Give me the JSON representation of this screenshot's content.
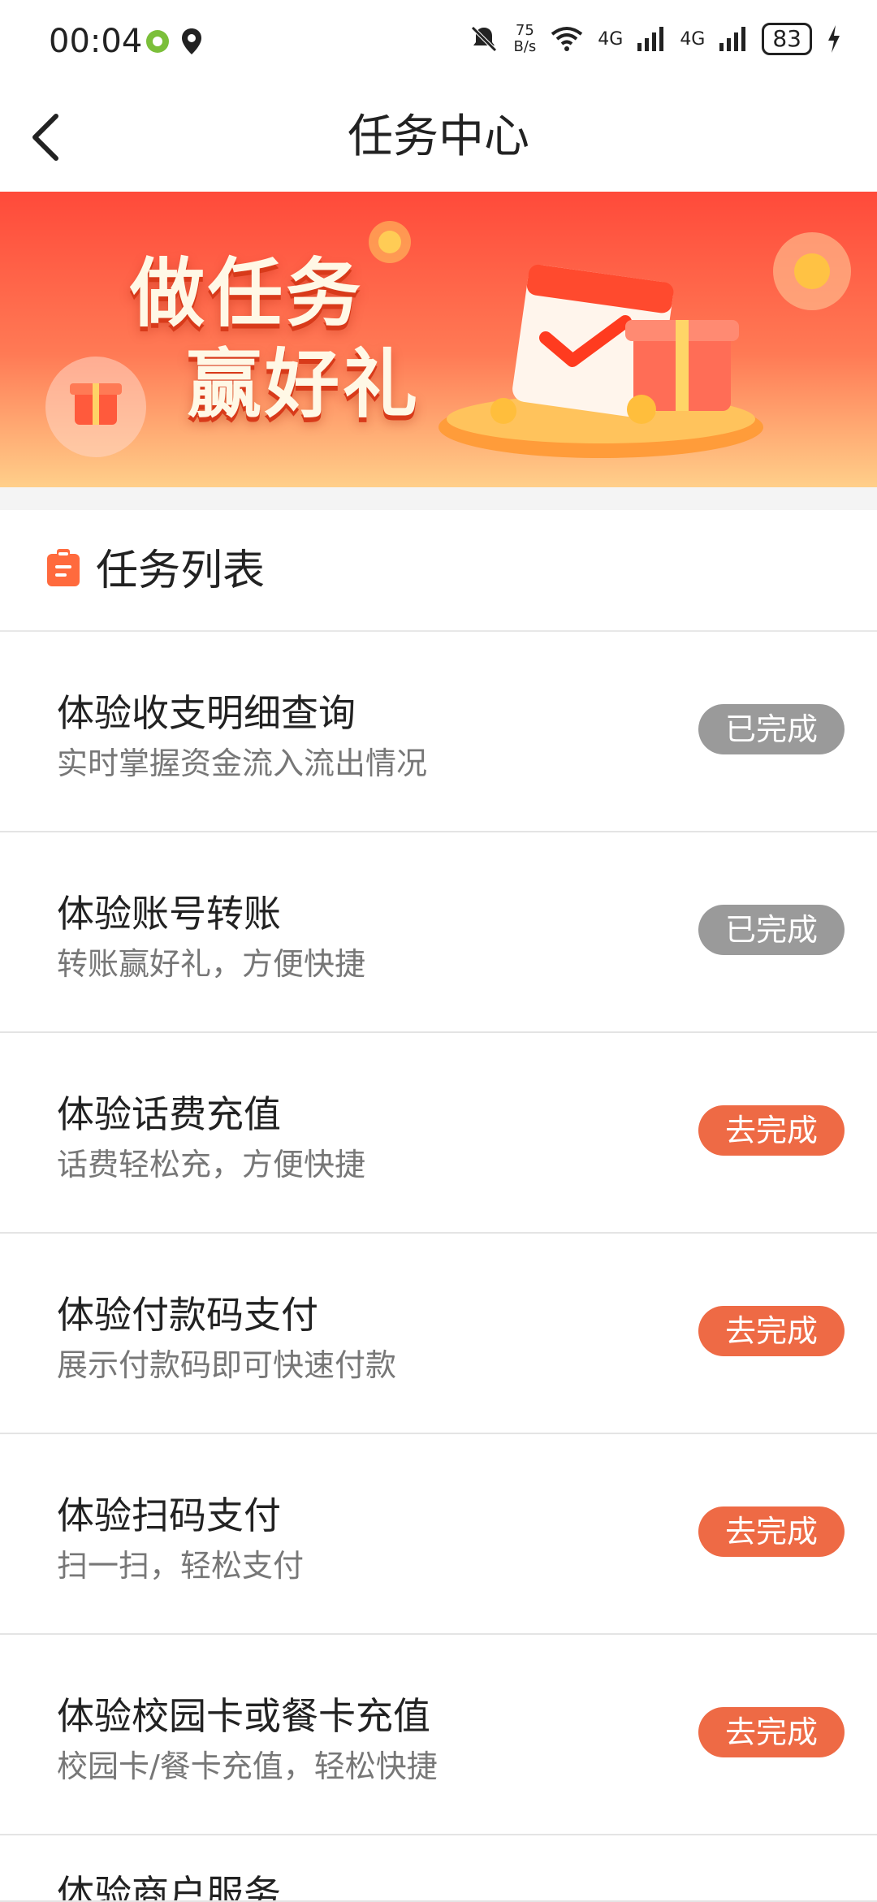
{
  "status": {
    "time": "00:04",
    "net_speed_top": "75",
    "net_speed_bottom": "B/s",
    "net1": "4G",
    "net2": "4G",
    "battery": "83"
  },
  "nav": {
    "title": "任务中心"
  },
  "banner": {
    "line1": "做任务",
    "line2": "赢好礼"
  },
  "section": {
    "title": "任务列表"
  },
  "tasks": [
    {
      "title": "体验收支明细查询",
      "desc": "实时掌握资金流入流出情况",
      "button": "已完成",
      "status": "done"
    },
    {
      "title": "体验账号转账",
      "desc": "转账赢好礼，方便快捷",
      "button": "已完成",
      "status": "done"
    },
    {
      "title": "体验话费充值",
      "desc": "话费轻松充，方便快捷",
      "button": "去完成",
      "status": "todo"
    },
    {
      "title": "体验付款码支付",
      "desc": "展示付款码即可快速付款",
      "button": "去完成",
      "status": "todo"
    },
    {
      "title": "体验扫码支付",
      "desc": "扫一扫，轻松支付",
      "button": "去完成",
      "status": "todo"
    },
    {
      "title": "体验校园卡或餐卡充值",
      "desc": "校园卡/餐卡充值，轻松快捷",
      "button": "去完成",
      "status": "todo"
    },
    {
      "title": "体验商户服务",
      "desc": "",
      "button": "",
      "status": "cut"
    }
  ],
  "colors": {
    "accent": "#ee6a45",
    "done": "#9a9a9a",
    "banner_top": "#ff4a3a",
    "banner_bottom": "#ffcf8a"
  }
}
